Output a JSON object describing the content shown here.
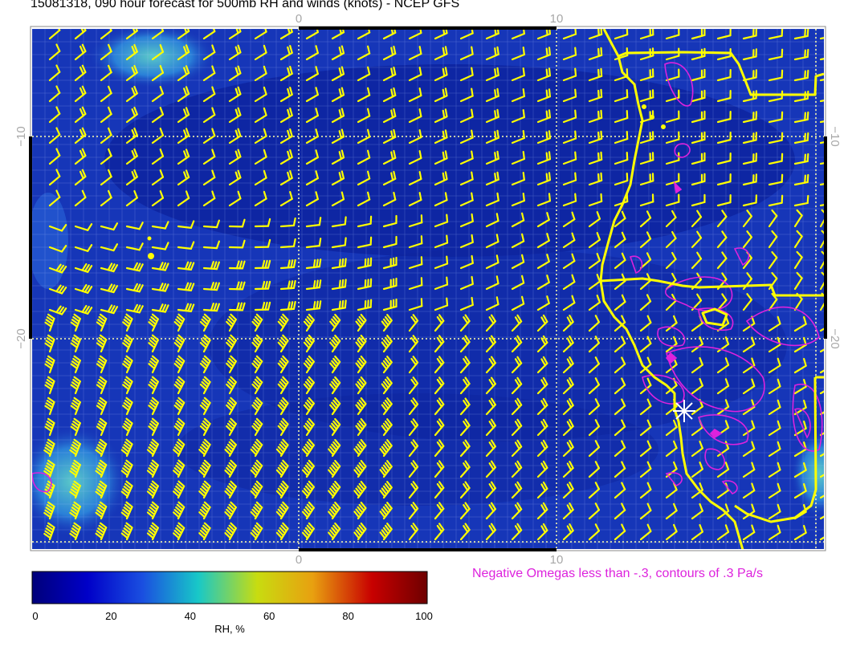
{
  "title": "15081318, 090 hour forecast for 500mb RH and winds (knots) - NCEP GFS",
  "lon_ticks": [
    "0",
    "10"
  ],
  "lat_ticks": [
    "−10",
    "−20"
  ],
  "colorbar": {
    "min": 0,
    "max": 100,
    "ticks": [
      "0",
      "20",
      "40",
      "60",
      "80",
      "100"
    ],
    "label": "RH, %",
    "colors": [
      "#00007a",
      "#0000c8",
      "#1a4fe0",
      "#18c8c8",
      "#c8dc10",
      "#e8a010",
      "#c80000",
      "#6e0000"
    ]
  },
  "omega_note": "Negative Omegas less than -.3, contours of .3 Pa/s",
  "colors": {
    "background_field": "#1636b8",
    "wind_barb": "#ffff00",
    "coastline": "#ffff00",
    "omega_contour": "#dd22dd",
    "grid": "#ffffaa",
    "tick_text": "#a8a8a8"
  },
  "map": {
    "field": "500mb relative humidity",
    "wind_units": "knots",
    "station_marker": "white-asterisk"
  }
}
